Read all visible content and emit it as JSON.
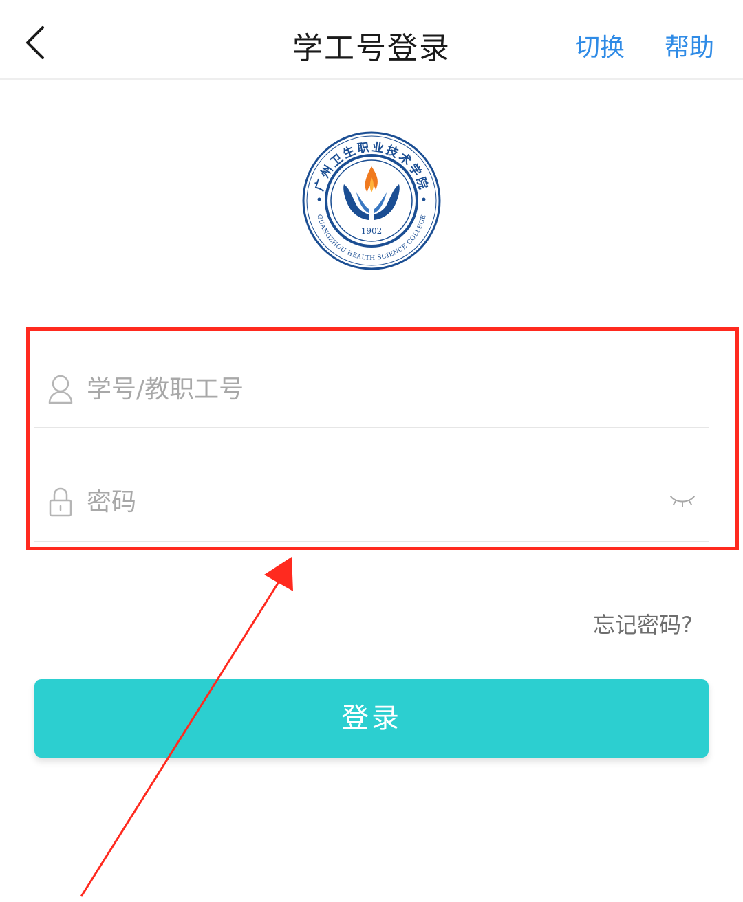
{
  "header": {
    "title": "学工号登录",
    "switch_label": "切换",
    "help_label": "帮助"
  },
  "logo": {
    "name_cn": "广州卫生职业技术学院",
    "name_en": "GUANGZHOU HEALTH SCIENCE COLLEGE",
    "year": "1902"
  },
  "form": {
    "account_placeholder": "学号/教职工号",
    "account_value": "",
    "password_placeholder": "密码",
    "password_value": ""
  },
  "forgot_label": "忘记密码?",
  "login_label": "登录",
  "colors": {
    "accent": "#2ccfd0",
    "link": "#2f8be6",
    "highlight": "#ff2a1f"
  }
}
